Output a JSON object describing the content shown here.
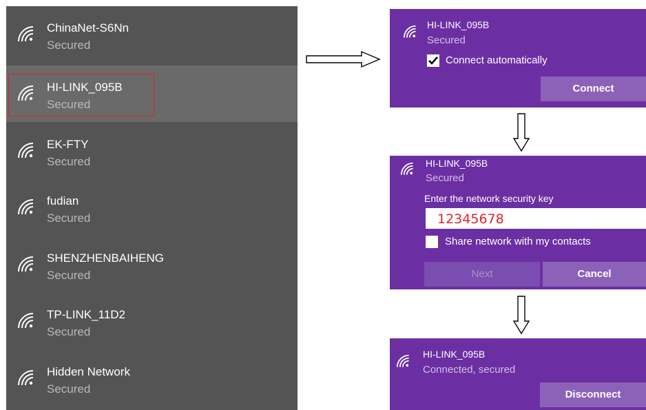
{
  "wifi_list": {
    "networks": [
      {
        "name": "ChinaNet-S6Nn",
        "status": "Secured"
      },
      {
        "name": "HI-LINK_095B",
        "status": "Secured"
      },
      {
        "name": "EK-FTY",
        "status": "Secured"
      },
      {
        "name": "fudian",
        "status": "Secured"
      },
      {
        "name": "SHENZHENBAIHENG",
        "status": "Secured"
      },
      {
        "name": "TP-LINK_11D2",
        "status": "Secured"
      },
      {
        "name": "Hidden Network",
        "status": "Secured"
      }
    ],
    "selected_index": 1
  },
  "step1": {
    "name": "HI-LINK_095B",
    "status": "Secured",
    "auto_connect_label": "Connect automatically",
    "auto_connect_checked": true,
    "connect_button": "Connect"
  },
  "step2": {
    "name": "HI-LINK_095B",
    "status": "Secured",
    "prompt": "Enter the network security key",
    "key_value": "12345678",
    "share_label": "Share network with my contacts",
    "share_checked": false,
    "next_button": "Next",
    "cancel_button": "Cancel"
  },
  "step3": {
    "name": "HI-LINK_095B",
    "status": "Connected, secured",
    "disconnect_button": "Disconnect"
  },
  "colors": {
    "list_bg": "#545454",
    "list_highlight": "#6a6a6a",
    "selection_border": "#d9252a",
    "panel_bg": "#6b2fa3",
    "key_text": "#e0262b"
  },
  "icons": {
    "network": "wifi-icon",
    "checked": "checkmark-icon",
    "flow": "arrow-icon"
  }
}
